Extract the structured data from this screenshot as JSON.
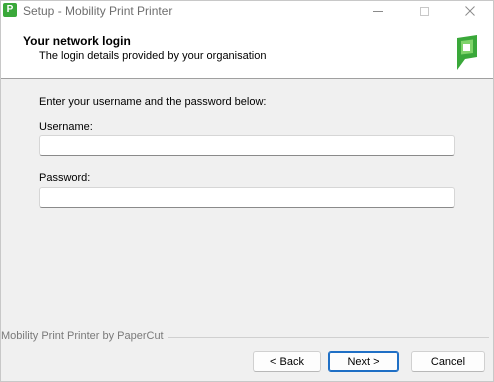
{
  "window": {
    "title": "Setup - Mobility Print Printer",
    "icon_name": "papercut-app-icon",
    "icon_letter": "P"
  },
  "header": {
    "title": "Your network login",
    "subtitle": "The login details provided by your organisation",
    "logo_name": "papercut-logo-icon"
  },
  "body": {
    "prompt": "Enter your username and the password below:",
    "username": {
      "label": "Username:",
      "value": ""
    },
    "password": {
      "label": "Password:",
      "value": ""
    }
  },
  "footer": {
    "brand": "Mobility Print Printer by PaperCut",
    "back_label": "< Back",
    "next_label": "Next >",
    "cancel_label": "Cancel"
  },
  "colors": {
    "accent": "#1f6fc5",
    "logo_green": "#3aa83a"
  }
}
